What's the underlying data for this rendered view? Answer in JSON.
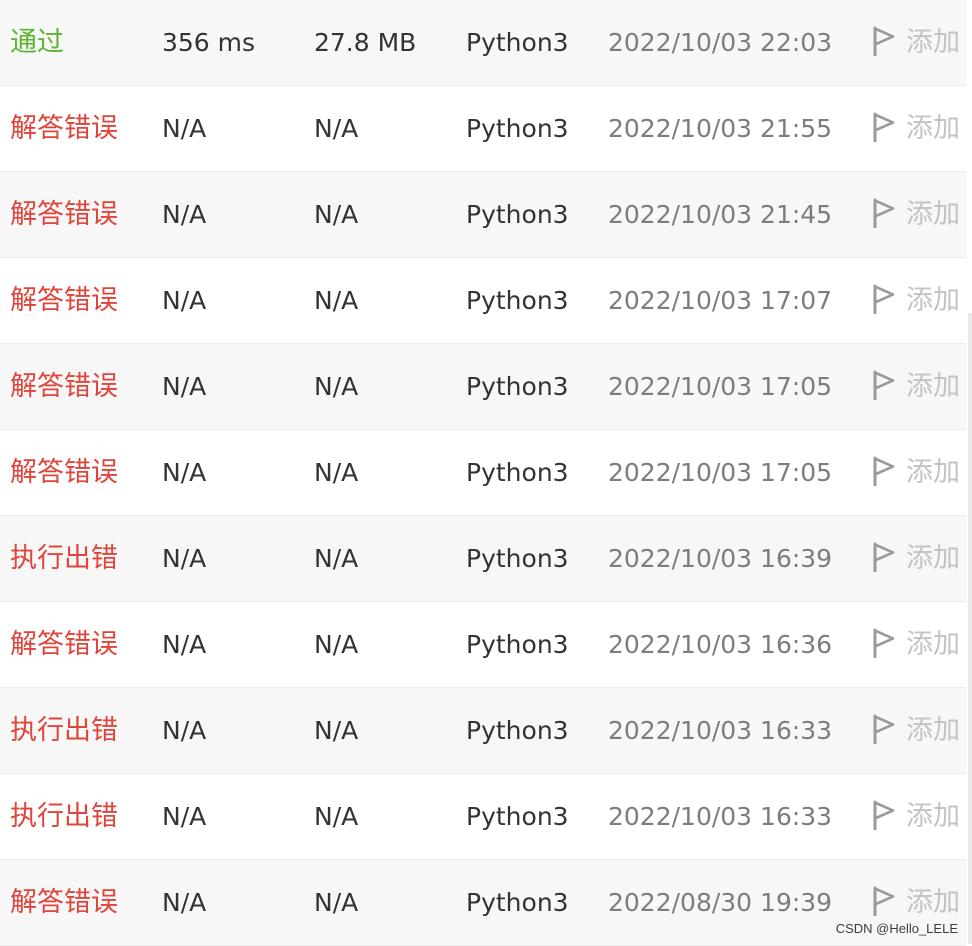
{
  "colors": {
    "accepted": "#5cb531",
    "error": "#e0443a",
    "text": "#333333",
    "time": "#7d7d7d",
    "note": "#c3c3c3",
    "row_alt": "#f7f7f7"
  },
  "note_icon": "flag-icon",
  "submissions": [
    {
      "status": "通过",
      "result": "accepted",
      "runtime": "356 ms",
      "memory": "27.8 MB",
      "language": "Python3",
      "time": "2022/10/03 22:03",
      "note": "添加"
    },
    {
      "status": "解答错误",
      "result": "error",
      "runtime": "N/A",
      "memory": "N/A",
      "language": "Python3",
      "time": "2022/10/03 21:55",
      "note": "添加"
    },
    {
      "status": "解答错误",
      "result": "error",
      "runtime": "N/A",
      "memory": "N/A",
      "language": "Python3",
      "time": "2022/10/03 21:45",
      "note": "添加"
    },
    {
      "status": "解答错误",
      "result": "error",
      "runtime": "N/A",
      "memory": "N/A",
      "language": "Python3",
      "time": "2022/10/03 17:07",
      "note": "添加"
    },
    {
      "status": "解答错误",
      "result": "error",
      "runtime": "N/A",
      "memory": "N/A",
      "language": "Python3",
      "time": "2022/10/03 17:05",
      "note": "添加"
    },
    {
      "status": "解答错误",
      "result": "error",
      "runtime": "N/A",
      "memory": "N/A",
      "language": "Python3",
      "time": "2022/10/03 17:05",
      "note": "添加"
    },
    {
      "status": "执行出错",
      "result": "error",
      "runtime": "N/A",
      "memory": "N/A",
      "language": "Python3",
      "time": "2022/10/03 16:39",
      "note": "添加"
    },
    {
      "status": "解答错误",
      "result": "error",
      "runtime": "N/A",
      "memory": "N/A",
      "language": "Python3",
      "time": "2022/10/03 16:36",
      "note": "添加"
    },
    {
      "status": "执行出错",
      "result": "error",
      "runtime": "N/A",
      "memory": "N/A",
      "language": "Python3",
      "time": "2022/10/03 16:33",
      "note": "添加"
    },
    {
      "status": "执行出错",
      "result": "error",
      "runtime": "N/A",
      "memory": "N/A",
      "language": "Python3",
      "time": "2022/10/03 16:33",
      "note": "添加"
    },
    {
      "status": "解答错误",
      "result": "error",
      "runtime": "N/A",
      "memory": "N/A",
      "language": "Python3",
      "time": "2022/08/30 19:39",
      "note": "添加"
    }
  ],
  "watermark": "CSDN @Hello_LELE"
}
